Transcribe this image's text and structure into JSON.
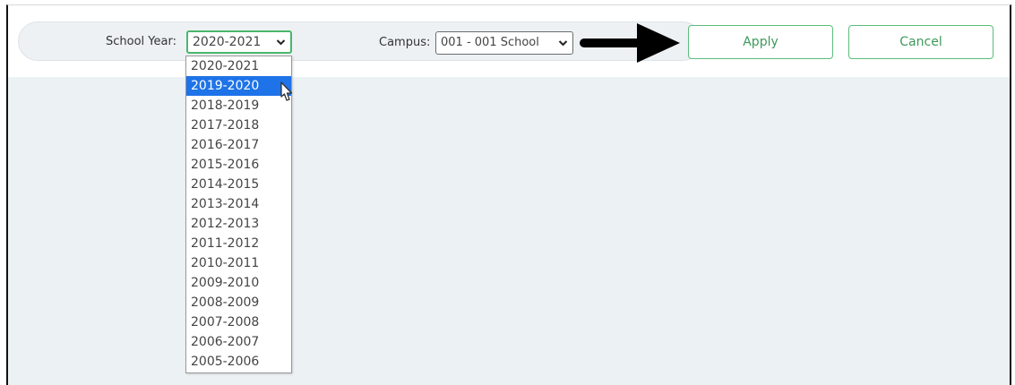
{
  "filters": {
    "school_year_label": "School Year:",
    "school_year_value": "2020-2021",
    "campus_label": "Campus:",
    "campus_value": "001 - 001 School"
  },
  "school_year_options": [
    "2020-2021",
    "2019-2020",
    "2018-2019",
    "2017-2018",
    "2016-2017",
    "2015-2016",
    "2014-2015",
    "2013-2014",
    "2012-2013",
    "2011-2012",
    "2010-2011",
    "2009-2010",
    "2008-2009",
    "2007-2008",
    "2006-2007",
    "2005-2006"
  ],
  "highlighted_option": "2019-2020",
  "buttons": {
    "apply": "Apply",
    "cancel": "Cancel"
  },
  "colors": {
    "accent_green": "#49b76a",
    "highlight_blue": "#1e73e8",
    "panel_bg": "#ecf1f4"
  },
  "icons": {
    "select_chevron": "chevron-down-icon",
    "pointer": "mouse-pointer-icon",
    "callout": "arrow-right-icon"
  }
}
